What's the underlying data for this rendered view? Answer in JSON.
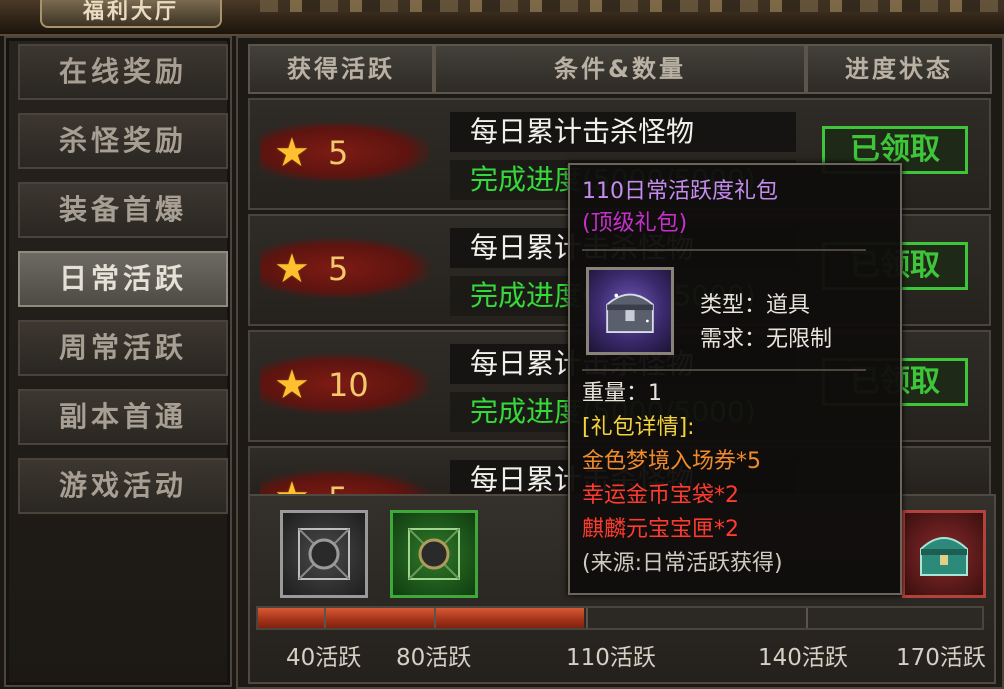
{
  "header": {
    "title": "福利大厅"
  },
  "sidebar": {
    "items": [
      {
        "label": "在线奖励",
        "active": false
      },
      {
        "label": "杀怪奖励",
        "active": false
      },
      {
        "label": "装备首爆",
        "active": false
      },
      {
        "label": "日常活跃",
        "active": true
      },
      {
        "label": "周常活跃",
        "active": false
      },
      {
        "label": "副本首通",
        "active": false
      },
      {
        "label": "游戏活动",
        "active": false
      }
    ]
  },
  "table": {
    "headers": [
      "获得活跃",
      "条件&数量",
      "进度状态"
    ],
    "rows": [
      {
        "points": "5",
        "task": "每日累计击杀怪物",
        "progress": "完成进度(5000/5000)",
        "status": "已领取"
      },
      {
        "points": "5",
        "task": "每日累计击杀怪物",
        "progress": "完成进度(5000/5000)",
        "status": "已领取"
      },
      {
        "points": "10",
        "task": "每日累计击杀怪物",
        "progress": "完成进度(5000/5000)",
        "status": "已领取"
      },
      {
        "points": "5",
        "task": "每日累计击杀怪物",
        "progress": "",
        "status": ""
      }
    ]
  },
  "activity_bar": {
    "progress_fraction": 0.45,
    "milestones": [
      "40活跃",
      "80活跃",
      "110活跃",
      "140活跃",
      "170活跃"
    ],
    "chest_icons": [
      "silver-chest-icon",
      "green-chest-icon",
      "jade-chest-icon"
    ]
  },
  "tooltip": {
    "title": "110日常活跃度礼包",
    "subtitle": "(顶级礼包)",
    "type_line": "类型：道具",
    "req_line": "需求：无限制",
    "weight_line": "重量：1",
    "details_header": "[礼包详情]:",
    "items": [
      {
        "text": "金色梦境入场券*5",
        "color": "#f08a2a"
      },
      {
        "text": "幸运金币宝袋*2",
        "color": "#ff3b2f"
      },
      {
        "text": "麒麟元宝宝匣*2",
        "color": "#ff3b2f"
      }
    ],
    "source": "(来源:日常活跃获得)",
    "colors": {
      "title": "#c58cf0",
      "subtitle": "#c531c9",
      "header": "#f4d23a",
      "text": "#e8e4dc",
      "source": "#cfcac0"
    }
  }
}
